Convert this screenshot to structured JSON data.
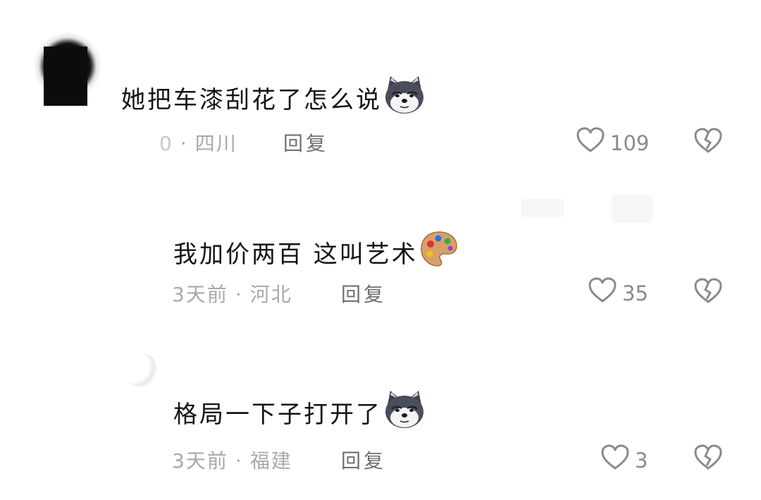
{
  "comments": [
    {
      "text": "她把车漆刮花了怎么说",
      "emoji": "doge-icon",
      "time": "0",
      "location": "四川",
      "reply": "回复",
      "likes": "109"
    },
    {
      "text": "我加价两百 这叫艺术",
      "emoji": "palette-icon",
      "time": "3天前",
      "location": "河北",
      "reply": "回复",
      "likes": "35"
    },
    {
      "text": "格局一下子打开了",
      "emoji": "doge-icon",
      "time": "3天前",
      "location": "福建",
      "reply": "回复",
      "likes": "3"
    }
  ],
  "colors": {
    "text": "#141414",
    "meta": "#a9a9a9",
    "reply": "#6f6f6f",
    "icon": "#8a8a8a"
  }
}
